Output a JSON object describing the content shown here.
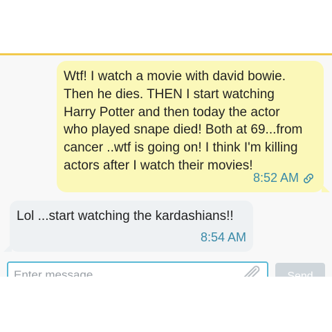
{
  "messages": [
    {
      "direction": "outgoing",
      "text": "Wtf!  I watch a movie with david bowie.\nThen he dies.  THEN I start watching\nHarry Potter and then today the actor\nwho played snape died! Both at 69...from\ncancer ..wtf is going on!  I think I'm killing\nactors after I watch their movies!",
      "time": "8:52 AM",
      "status_icon": "link-icon"
    },
    {
      "direction": "incoming",
      "text": "Lol ...start watching the kardashians!!",
      "time": "8:54 AM"
    }
  ],
  "composer": {
    "placeholder": "Enter message",
    "attach_icon": "paperclip-icon",
    "send_label": "Send"
  },
  "colors": {
    "accent": "#f2c94c",
    "outgoing_bubble": "#fbf8b9",
    "incoming_bubble": "#eef1f3",
    "timestamp": "#3a8aa8",
    "input_border": "#5ab9d6"
  }
}
